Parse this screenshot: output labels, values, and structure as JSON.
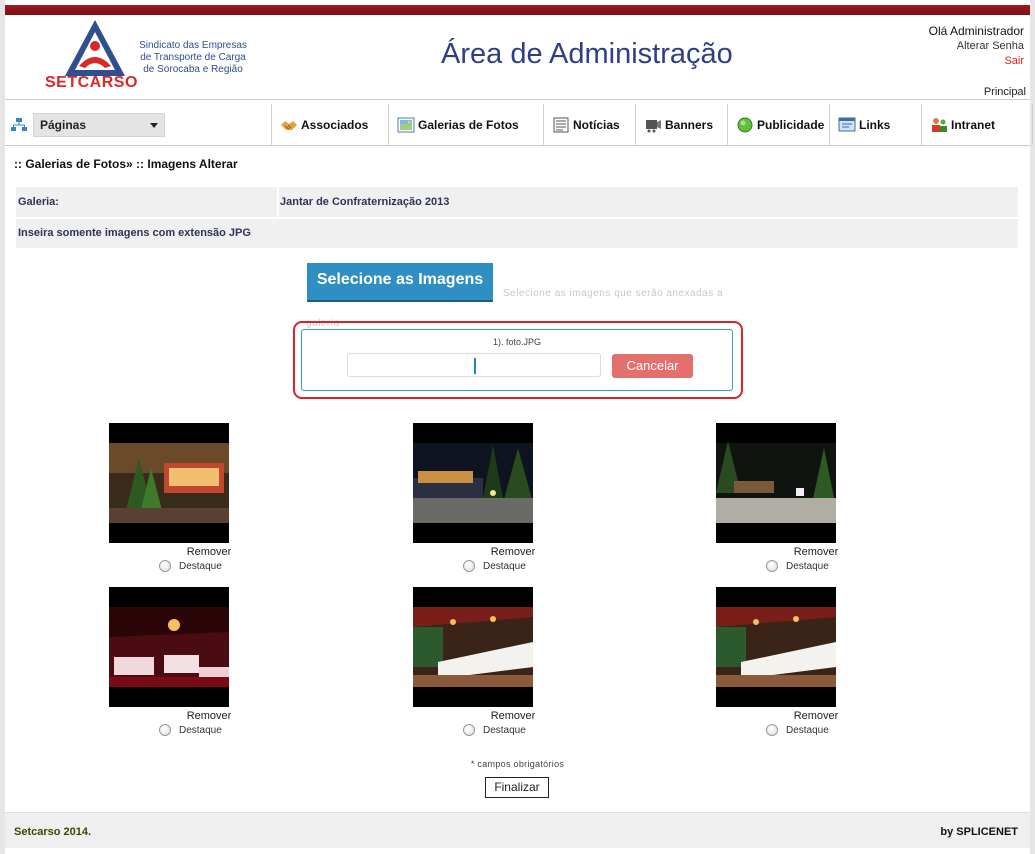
{
  "header": {
    "logo_text": "SETCARSO",
    "logo_subtitle_lines": [
      "Sindicato das Empresas",
      "de Transporte de Carga",
      "de Sorocaba e Região"
    ],
    "title": "Área de Administração",
    "greeting": "Olá Administrador",
    "change_password": "Alterar Senha",
    "logout": "Sair",
    "principal": "Principal"
  },
  "nav": {
    "pages_select": "Páginas",
    "items": [
      {
        "label": "Associados",
        "icon": "handshake-icon"
      },
      {
        "label": "Galerias de Fotos",
        "icon": "photo-gallery-icon"
      },
      {
        "label": "Notícias",
        "icon": "news-icon"
      },
      {
        "label": "Banners",
        "icon": "banner-icon"
      },
      {
        "label": "Publicidade",
        "icon": "globe-icon"
      },
      {
        "label": "Links",
        "icon": "links-icon"
      },
      {
        "label": "Intranet",
        "icon": "users-icon"
      }
    ]
  },
  "breadcrumb": ":: Galerias de Fotos» :: Imagens Alterar",
  "gallery_row": {
    "label": "Galeria:",
    "value": "Jantar de Confraternização 2013"
  },
  "notice": "Inseira somente imagens com extensão JPG",
  "upload": {
    "button": "Selecione as Imagens",
    "hint": "Selecione as imagens que serão anexadas a galeria",
    "file_name": "1). foto.JPG",
    "progress": 0.5,
    "cancel": "Cancelar"
  },
  "images": [
    {
      "scene": "courtyard",
      "remove": "Remover",
      "feature": "Destaque"
    },
    {
      "scene": "night-driveway",
      "remove": "Remover",
      "feature": "Destaque"
    },
    {
      "scene": "night-entrance",
      "remove": "Remover",
      "feature": "Destaque"
    },
    {
      "scene": "red-dining",
      "remove": "Remover",
      "feature": "Destaque"
    },
    {
      "scene": "buffet-hall",
      "remove": "Remover",
      "feature": "Destaque"
    },
    {
      "scene": "buffet-hall",
      "remove": "Remover",
      "feature": "Destaque"
    }
  ],
  "required_note": "* campos obrigatórios",
  "finalize": "Finalizar",
  "footer": {
    "left": "Setcarso 2014.",
    "right": "by SPLICENET"
  },
  "colors": {
    "brand_red": "#d8282a",
    "title_blue": "#2e3f84",
    "button_blue": "#2f8fc2",
    "cancel_red": "#e3706c"
  }
}
